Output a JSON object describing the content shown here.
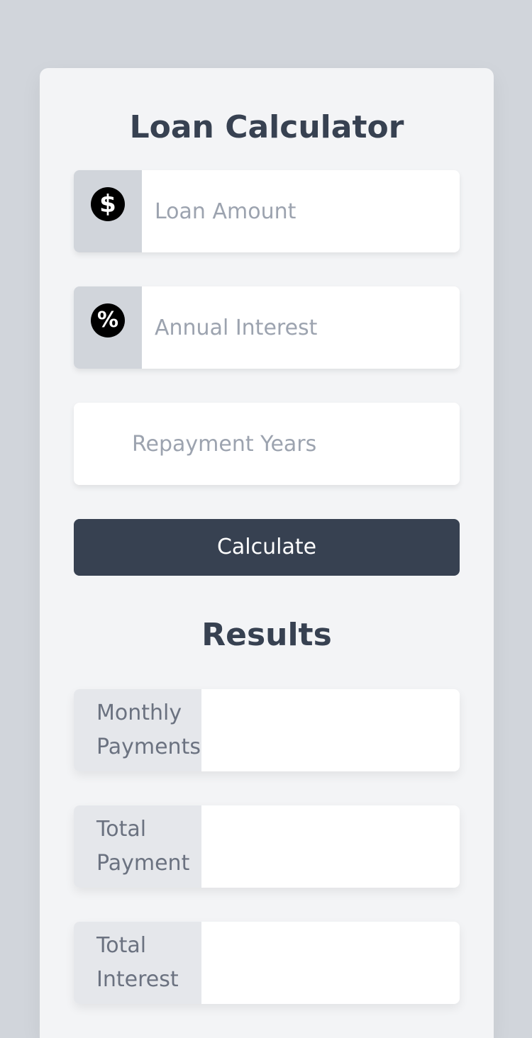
{
  "app": {
    "title": "Loan Calculator"
  },
  "form": {
    "loan_amount": {
      "placeholder": "Loan Amount",
      "value": "",
      "icon": "dollar-icon",
      "glyph": "$"
    },
    "annual_interest": {
      "placeholder": "Annual Interest",
      "value": "",
      "icon": "percent-icon",
      "glyph": "%"
    },
    "repayment_years": {
      "placeholder": "Repayment Years",
      "value": ""
    }
  },
  "calculate_button": {
    "label": "Calculate"
  },
  "results": {
    "title": "Results",
    "monthly_payments": {
      "label_line1": "Monthly",
      "label_line2": "Payments",
      "value": ""
    },
    "total_payment": {
      "label_line1": "Total",
      "label_line2": "Payment",
      "value": ""
    },
    "total_interest": {
      "label_line1": "Total",
      "label_line2": "Interest",
      "value": ""
    }
  },
  "colors": {
    "page_background": "#d1d5db",
    "card_background": "#f3f4f6",
    "button_background": "#374151",
    "heading_text": "#374151",
    "placeholder_text": "#9ca3af",
    "result_label_background": "#e5e7eb"
  }
}
